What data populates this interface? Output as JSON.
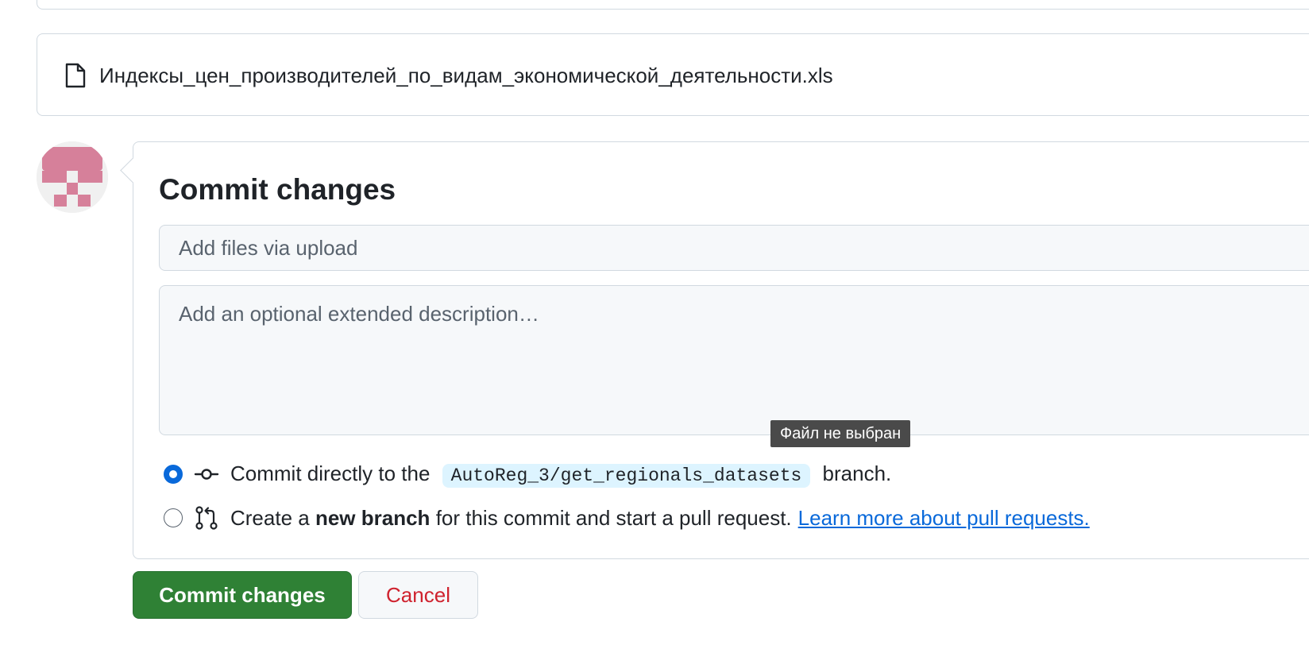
{
  "file": {
    "icon": "file-icon",
    "name": "Индексы_цен_производителей_по_видам_экономической_деятельности.xls"
  },
  "avatar": {
    "icon": "identicon-avatar",
    "color": "#d6809a"
  },
  "commit": {
    "title": "Commit changes",
    "summary_placeholder": "Add files via upload",
    "summary_value": "",
    "description_placeholder": "Add an optional extended description…",
    "description_value": "",
    "options": {
      "direct": {
        "selected": true,
        "icon": "git-commit-icon",
        "prefix": "Commit directly to the",
        "branch": "AutoReg_3/get_regionals_datasets",
        "suffix": "branch."
      },
      "new_branch": {
        "selected": false,
        "icon": "git-pull-request-icon",
        "prefix": "Create a",
        "strong": "new branch",
        "suffix": "for this commit and start a pull request.",
        "link": "Learn more about pull requests."
      }
    }
  },
  "tooltip": {
    "text": "Файл не выбран"
  },
  "buttons": {
    "commit": "Commit changes",
    "cancel": "Cancel"
  },
  "colors": {
    "primary_button": "#2f8135",
    "danger_text": "#cf222e",
    "accent": "#0969da",
    "branch_bg": "#ddf4ff",
    "border": "#d1d9e0"
  }
}
